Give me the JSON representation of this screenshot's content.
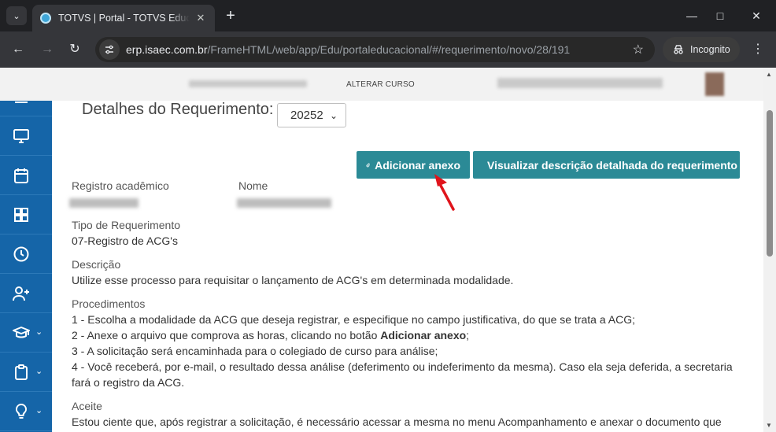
{
  "browser": {
    "tab_title": "TOTVS | Portal - TOTVS Educacional",
    "url_host": "erp.isaec.com.br",
    "url_path": "/FrameHTML/web/app/Edu/portaleducacional/#/requerimento/novo/28/191",
    "profile_label": "Incognito"
  },
  "header": {
    "alterar_curso": "ALTERAR CURSO"
  },
  "sidebar": {
    "items": [
      {
        "icon": "menu-icon"
      },
      {
        "icon": "monitor-icon"
      },
      {
        "icon": "calendar-icon"
      },
      {
        "icon": "grid-icon"
      },
      {
        "icon": "clock-icon"
      },
      {
        "icon": "user-plus-icon"
      },
      {
        "icon": "graduation-cap-icon"
      },
      {
        "icon": "clipboard-icon"
      },
      {
        "icon": "lightbulb-icon"
      }
    ]
  },
  "main": {
    "heading": "Detalhes do Requerimento:",
    "year_selected": "20252",
    "btn_attach": "Adicionar anexo",
    "btn_view_desc": "Visualizar descrição detalhada do requerimento",
    "registro_label": "Registro acadêmico",
    "nome_label": "Nome",
    "tipo_label": "Tipo de Requerimento",
    "tipo_value": "07-Registro de ACG's",
    "descricao_label": "Descrição",
    "descricao_value": "Utilize esse processo para requisitar o lançamento de ACG's em determinada modalidade.",
    "procedimentos_label": "Procedimentos",
    "proc_1": "1 - Escolha a modalidade da ACG que deseja registrar, e especifique no campo justificativa, do que se trata a ACG;",
    "proc_2_pre": "2 - Anexe o arquivo que comprova as horas, clicando no botão ",
    "proc_2_bold": "Adicionar anexo",
    "proc_2_post": ";",
    "proc_3": "3 - A solicitação será encaminhada para o colegiado de curso para análise;",
    "proc_4a": "4 - Você receberá, por e-mail, o resultado dessa análise (deferimento ou indeferimento da mesma). Caso ela seja deferida, a secretaria",
    "proc_4b": "fará o registro da ACG.",
    "aceite_label": "Aceite",
    "aceite_value": "Estou ciente que, após registrar a solicitação, é necessário acessar a mesma no menu Acompanhamento e anexar o documento que"
  },
  "colors": {
    "sidebar": "#1565a8",
    "button": "#2b8a96",
    "arrow": "#e0141c"
  }
}
